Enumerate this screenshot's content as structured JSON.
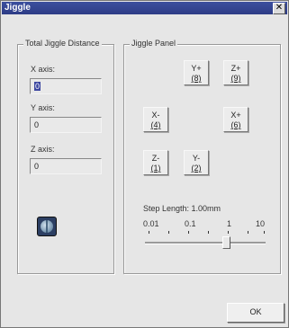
{
  "window": {
    "title": "Jiggle",
    "close_glyph": "✕"
  },
  "distance_group": {
    "title": "Total Jiggle Distance",
    "fields": [
      {
        "label": "X axis:",
        "value": "0"
      },
      {
        "label": "Y axis:",
        "value": "0"
      },
      {
        "label": "Z axis:",
        "value": "0"
      }
    ],
    "icon": "globe-icon"
  },
  "jiggle_panel": {
    "title": "Jiggle Panel",
    "buttons": {
      "y_plus": {
        "label": "Y+",
        "key": "(8)"
      },
      "z_plus": {
        "label": "Z+",
        "key": "(9)"
      },
      "x_minus": {
        "label": "X-",
        "key": "(4)"
      },
      "x_plus": {
        "label": "X+",
        "key": "(6)"
      },
      "z_minus": {
        "label": "Z-",
        "key": "(1)"
      },
      "y_minus": {
        "label": "Y-",
        "key": "(2)"
      }
    },
    "step_length_text": "Step Length: 1.00mm",
    "slider": {
      "tick_labels": [
        "0.01",
        "0.1",
        "1",
        "10"
      ],
      "current_value": "1.00"
    }
  },
  "ok_button": {
    "label": "OK"
  }
}
